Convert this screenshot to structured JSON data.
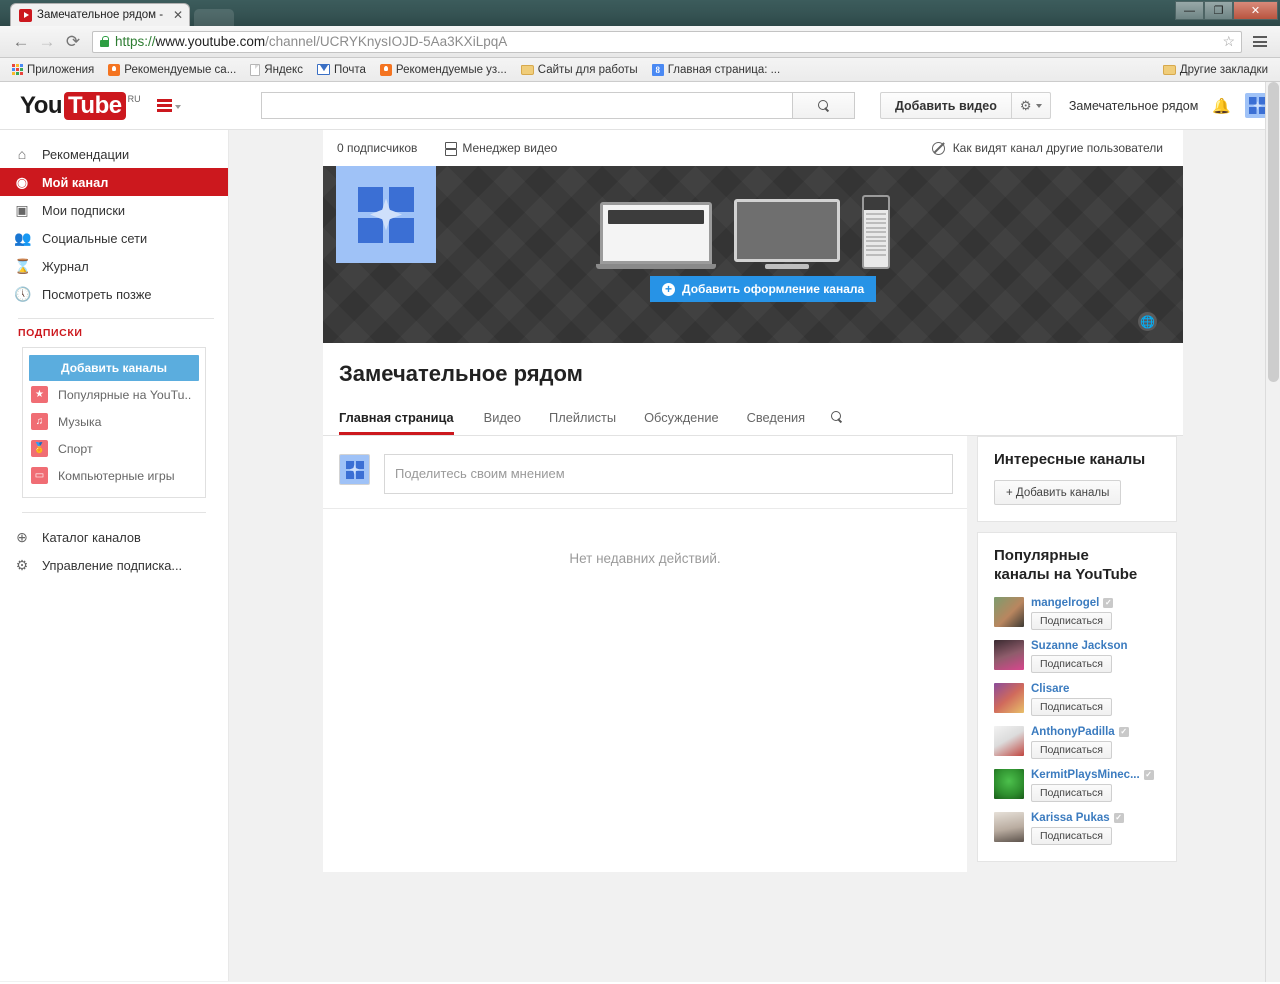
{
  "browser": {
    "tab_title": "Замечательное рядом - ",
    "tab_close": "✕",
    "nav": {
      "back": "←",
      "forward": "→",
      "reload": "⟳"
    },
    "url": {
      "scheme": "https://",
      "host": "www.youtube.com",
      "path": "/channel/UCRYKnysIOJD-5Aa3KXiLpqA"
    },
    "star_icon": "☆",
    "window": {
      "minimize": "—",
      "maximize": "❐",
      "close": "✕"
    },
    "bookmarks": [
      {
        "label": "Приложения",
        "icon": "apps-grid-icon"
      },
      {
        "label": "Рекомендуемые са...",
        "icon": "bulb-icon"
      },
      {
        "label": "Яндекс",
        "icon": "document-icon"
      },
      {
        "label": "Почта",
        "icon": "mail-icon"
      },
      {
        "label": "Рекомендуемые уз...",
        "icon": "bulb-icon"
      },
      {
        "label": "Сайты для работы",
        "icon": "folder-icon"
      },
      {
        "label": "Главная страница: ...",
        "icon": "google-icon"
      }
    ],
    "other_bookmarks": {
      "label": "Другие закладки",
      "icon": "folder-icon"
    }
  },
  "masthead": {
    "logo_you": "You",
    "logo_tube": "Tube",
    "logo_locale": "RU",
    "search_value": "",
    "search_placeholder": "",
    "search_button_icon": "search-icon",
    "upload_label": "Добавить видео",
    "gear_icon": "gear-icon",
    "account_name": "Замечательное рядом",
    "bell_icon": "notifications-bell-icon",
    "avatar_icon": "user-avatar-icon"
  },
  "guide": {
    "items": [
      {
        "label": "Рекомендации",
        "icon": "home-icon",
        "active": false
      },
      {
        "label": "Мой канал",
        "icon": "account-circle-icon",
        "active": true
      },
      {
        "label": "Мои подписки",
        "icon": "subscriptions-icon",
        "active": false
      },
      {
        "label": "Социальные сети",
        "icon": "people-icon",
        "active": false
      },
      {
        "label": "Журнал",
        "icon": "history-hourglass-icon",
        "active": false
      },
      {
        "label": "Посмотреть позже",
        "icon": "clock-icon",
        "active": false
      }
    ],
    "subscriptions_heading": "ПОДПИСКИ",
    "add_channels_label": "Добавить каналы",
    "subscriptions": [
      {
        "label": "Популярные на YouTu..",
        "icon": "star-badge-icon"
      },
      {
        "label": "Музыка",
        "icon": "headphones-icon"
      },
      {
        "label": "Спорт",
        "icon": "trophy-icon"
      },
      {
        "label": "Компьютерные игры",
        "icon": "gamepad-icon"
      }
    ],
    "footer_items": [
      {
        "label": "Каталог каналов",
        "icon": "plus-circle-icon"
      },
      {
        "label": "Управление подписка...",
        "icon": "gear-icon"
      }
    ]
  },
  "channel": {
    "subscribers": "0 подписчиков",
    "video_manager": "Менеджер видео",
    "view_as_others": "Как видят канал другие пользователи",
    "view_as_icon": "no-entry-icon",
    "add_channel_art": "Добавить оформление канала",
    "globe_icon": "globe-icon",
    "title": "Замечательное рядом",
    "tabs": [
      {
        "label": "Главная страница",
        "active": true
      },
      {
        "label": "Видео",
        "active": false
      },
      {
        "label": "Плейлисты",
        "active": false
      },
      {
        "label": "Обсуждение",
        "active": false
      },
      {
        "label": "Сведения",
        "active": false
      }
    ],
    "tab_search_icon": "search-icon",
    "share_placeholder": "Поделитесь своим мнением",
    "share_value": "",
    "no_activity": "Нет недавних действий."
  },
  "rail": {
    "interesting_title": "Интересные каналы",
    "add_channels_label": "+ Добавить каналы",
    "popular_title": "Популярные\nканалы на YouTube",
    "popular_title_line1": "Популярные",
    "popular_title_line2": "каналы на YouTube",
    "subscribe_label": "Подписаться",
    "popular_channels": [
      {
        "name": "mangelrogel",
        "verified": true,
        "thumb_colors": [
          "#6f8f6a",
          "#c8a48a"
        ]
      },
      {
        "name": "Suzanne Jackson",
        "verified": false,
        "thumb_colors": [
          "#2b2b2b",
          "#d25a8e"
        ]
      },
      {
        "name": "Clisare",
        "verified": false,
        "thumb_colors": [
          "#7a4a8c",
          "#e06a6a"
        ]
      },
      {
        "name": "AnthonyPadilla",
        "verified": true,
        "thumb_colors": [
          "#efefef",
          "#c94f4f"
        ]
      },
      {
        "name": "KermitPlaysMinec...",
        "verified": true,
        "thumb_colors": [
          "#3aa03a",
          "#1d6b1d"
        ]
      },
      {
        "name": "Karissa Pukas",
        "verified": true,
        "thumb_colors": [
          "#d8d3cc",
          "#6e6159"
        ]
      }
    ]
  },
  "colors": {
    "youtube_red": "#cc181e",
    "link_blue": "#3b7bbf",
    "accent_blue": "#2793e6",
    "sub_button_blue": "#5badde"
  }
}
